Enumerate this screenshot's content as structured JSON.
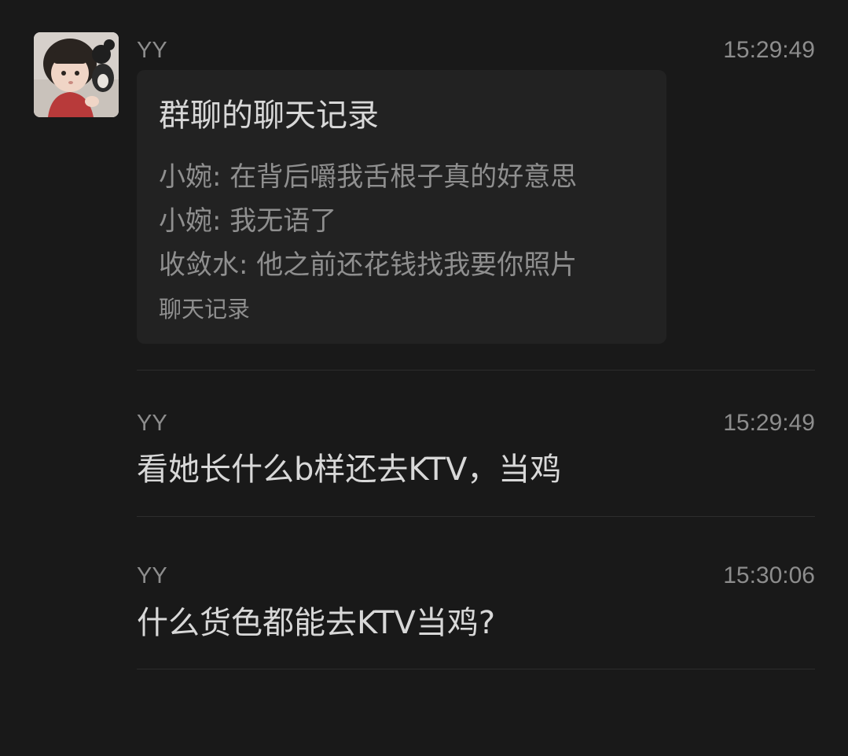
{
  "messages": [
    {
      "sender": "YY",
      "time": "15:29:49",
      "card": {
        "title": "群聊的聊天记录",
        "lines": [
          "小婉: 在背后嚼我舌根子真的好意思",
          "小婉: 我无语了",
          "收敛水: 他之前还花钱找我要你照片"
        ],
        "footer": "聊天记录"
      }
    },
    {
      "sender": "YY",
      "time": "15:29:49",
      "text": "看她长什么b样还去KTV，当鸡"
    },
    {
      "sender": "YY",
      "time": "15:30:06",
      "text": "什么货色都能去KTV当鸡?"
    }
  ],
  "colors": {
    "background": "#191919",
    "card_background": "#222222",
    "primary_text": "#d8d8d8",
    "secondary_text": "#8d8d8d",
    "divider": "#2d2d2d"
  }
}
